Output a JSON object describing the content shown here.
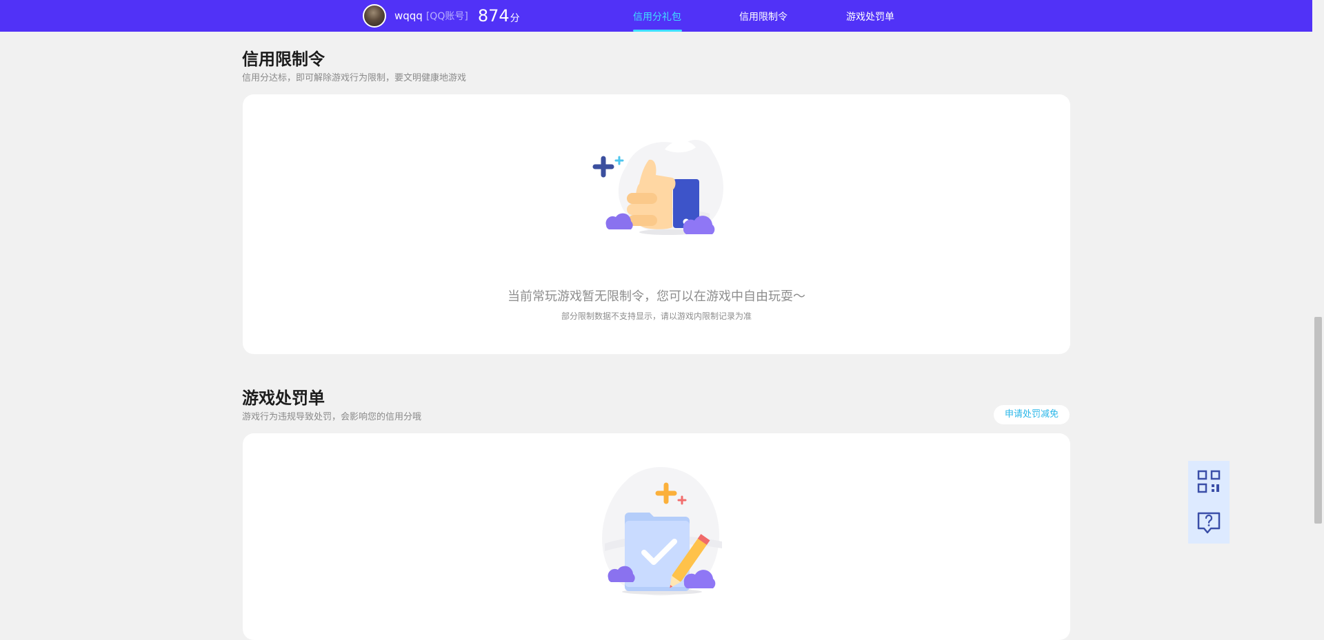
{
  "header": {
    "username": "wqqq",
    "account_type": "[QQ账号]",
    "score": "874",
    "score_unit": "分",
    "nav": [
      {
        "label": "信用分礼包",
        "active": true
      },
      {
        "label": "信用限制令",
        "active": false
      },
      {
        "label": "游戏处罚单",
        "active": false
      }
    ]
  },
  "restriction": {
    "title": "信用限制令",
    "subtitle": "信用分达标，即可解除游戏行为限制，要文明健康地游戏",
    "empty_text": "当前常玩游戏暂无限制令，您可以在游戏中自由玩耍～",
    "empty_note": "部分限制数据不支持显示，请以游戏内限制记录为准",
    "illustration": "thumbs-up-icon"
  },
  "penalty": {
    "title": "游戏处罚单",
    "subtitle": "游戏行为违规导致处罚，会影响您的信用分哦",
    "apply_label": "申请处罚减免",
    "illustration": "clipboard-check-icon"
  },
  "side_tools": [
    {
      "icon": "qr-code-icon"
    },
    {
      "icon": "help-chat-icon"
    }
  ],
  "colors": {
    "header_bg": "#5132f7",
    "active_nav": "#3fe0ff",
    "link": "#28b6e8"
  }
}
